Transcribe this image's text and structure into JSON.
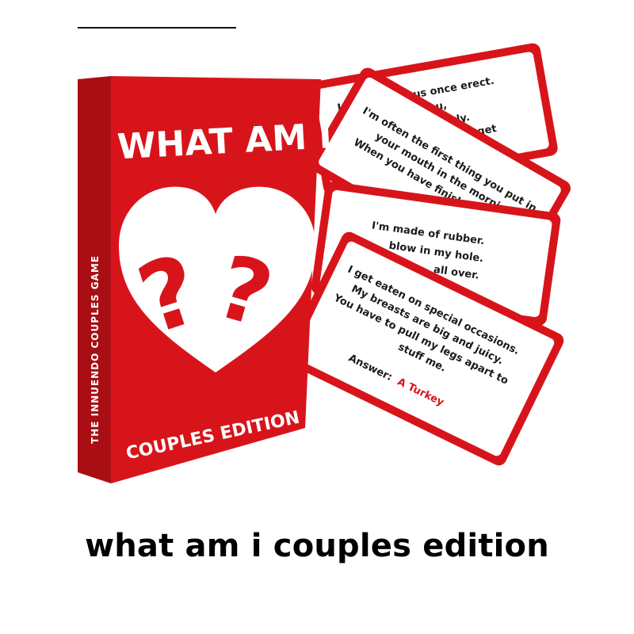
{
  "product": {
    "box": {
      "title": "WHAT AM I",
      "subtitle": "COUPLES EDITION",
      "side_text": "THE INNUENDO COUPLES GAME",
      "icon": "heart-with-question-marks"
    },
    "cards": [
      {
        "lines": [
          "I am dangerous once erect.",
          "penetrates you,",
          "comes quickly.",
          "your flutes get"
        ]
      },
      {
        "lines": [
          "I'm often the first thing you put in",
          "your mouth in the morning.",
          "When you have finished"
        ]
      },
      {
        "lines": [
          "I'm made of rubber.",
          "blow in my hole.",
          "all over."
        ]
      },
      {
        "lines": [
          "I get eaten on special occasions.",
          "My breasts are big and juicy.",
          "You have to pull my legs apart to",
          "stuff me."
        ],
        "answer_label": "Answer:",
        "answer_value": "A Turkey"
      }
    ]
  },
  "caption": "what am i couples edition",
  "colors": {
    "brand_red": "#d8141b",
    "box_shadow": "#a80e13"
  }
}
